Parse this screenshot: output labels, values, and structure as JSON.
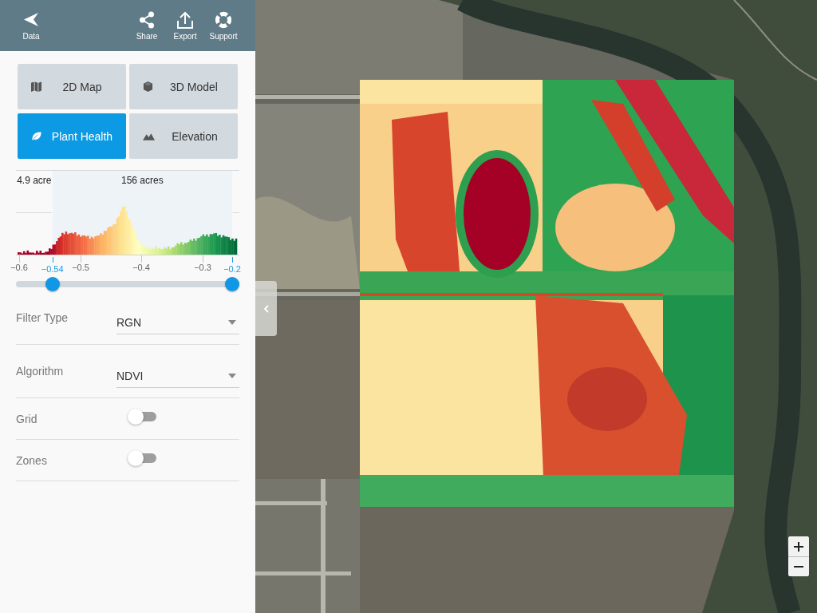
{
  "header": {
    "back": {
      "label": "Data"
    },
    "actions": [
      {
        "kind": "share",
        "label": "Share"
      },
      {
        "kind": "export",
        "label": "Export"
      },
      {
        "kind": "support",
        "label": "Support"
      }
    ]
  },
  "view_modes": [
    {
      "kind": "map",
      "label": "2D Map",
      "selected": false
    },
    {
      "kind": "model",
      "label": "3D Model",
      "selected": false
    },
    {
      "kind": "health",
      "label": "Plant Health",
      "selected": true
    },
    {
      "kind": "elevation",
      "label": "Elevation",
      "selected": false
    }
  ],
  "histogram": {
    "below_range_area": "4.9 acre",
    "in_range_area": "156 acres",
    "axis_ticks": [
      "−0.6",
      "−0.5",
      "−0.4",
      "−0.3"
    ],
    "thumbs": [
      {
        "level": 0.14,
        "reading": "−0.54"
      },
      {
        "level": 1,
        "reading": "−0.2"
      }
    ]
  },
  "settings": [
    {
      "kind": "dropdown",
      "label": "Filter Type",
      "value": "RGN"
    },
    {
      "kind": "dropdown",
      "label": "Algorithm",
      "value": "NDVI"
    },
    {
      "kind": "toggle",
      "label": "Grid",
      "on": false
    },
    {
      "kind": "toggle",
      "label": "Zones",
      "on": false
    }
  ]
}
